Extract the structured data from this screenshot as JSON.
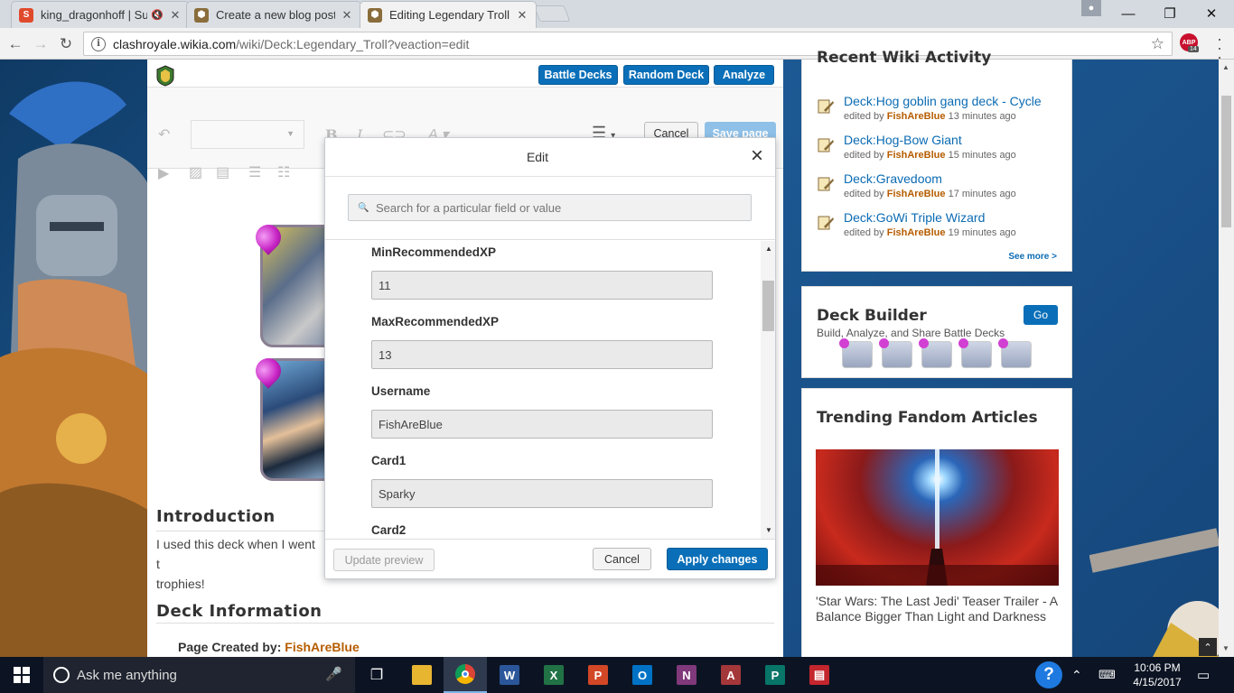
{
  "browser": {
    "tabs": [
      {
        "title": "king_dragonhoff | Sup",
        "favicon": "s-favicon",
        "muted": true
      },
      {
        "title": "Create a new blog post |",
        "favicon": "clash-favicon"
      },
      {
        "title": "Editing Legendary Troll -",
        "favicon": "clash-favicon",
        "active": true
      }
    ],
    "url_host": "clashroyale.wikia.com",
    "url_path": "/wiki/Deck:Legendary_Troll?veaction=edit",
    "extension_badge": "14"
  },
  "editor": {
    "header_buttons": [
      "Battle Decks",
      "Random Deck",
      "Analyze"
    ],
    "cancel_label": "Cancel",
    "save_label": "Save page"
  },
  "article": {
    "intro_heading": "Introduction",
    "intro_text_line1": "I used this deck when I went t",
    "intro_text_line2": "trophies!",
    "deck_info_heading": "Deck Information",
    "created_by_label": "Page Created by:",
    "created_by_user": "FishAreBlue"
  },
  "dialog": {
    "title": "Edit",
    "search_placeholder": "Search for a particular field or value",
    "fields": [
      {
        "label": "MinRecommendedXP",
        "value": "11"
      },
      {
        "label": "MaxRecommendedXP",
        "value": "13"
      },
      {
        "label": "Username",
        "value": "FishAreBlue"
      },
      {
        "label": "Card1",
        "value": "Sparky"
      },
      {
        "label": "Card2",
        "value": ""
      }
    ],
    "update_preview_label": "Update preview",
    "cancel_label": "Cancel",
    "apply_label": "Apply changes"
  },
  "rail": {
    "recent_heading": "Recent Wiki Activity",
    "recent": [
      {
        "title": "Deck:Hog goblin gang deck - Cycle",
        "by": "edited by",
        "user": "FishAreBlue",
        "when": "13 minutes ago"
      },
      {
        "title": "Deck:Hog-Bow Giant",
        "by": "edited by",
        "user": "FishAreBlue",
        "when": "15 minutes ago"
      },
      {
        "title": "Deck:Gravedoom",
        "by": "edited by",
        "user": "FishAreBlue",
        "when": "17 minutes ago"
      },
      {
        "title": "Deck:GoWi Triple Wizard",
        "by": "edited by",
        "user": "FishAreBlue",
        "when": "19 minutes ago"
      }
    ],
    "see_more": "See more >",
    "deck_builder_title": "Deck Builder",
    "deck_builder_sub": "Build, Analyze, and Share Battle Decks",
    "deck_builder_go": "Go",
    "trending_title": "Trending Fandom Articles",
    "trending_caption": "'Star Wars: The Last Jedi' Teaser Trailer - A Balance Bigger Than Light and Darkness"
  },
  "taskbar": {
    "search_placeholder": "Ask me anything",
    "apps": [
      "file-explorer",
      "chrome",
      "word",
      "excel",
      "powerpoint",
      "outlook",
      "onenote",
      "access",
      "publisher",
      "news"
    ],
    "time": "10:06 PM",
    "date": "4/15/2017"
  },
  "colors": {
    "accent_blue": "#0a6fb8",
    "user_link": "#b65c00",
    "link_blue": "#0b6bb3"
  }
}
